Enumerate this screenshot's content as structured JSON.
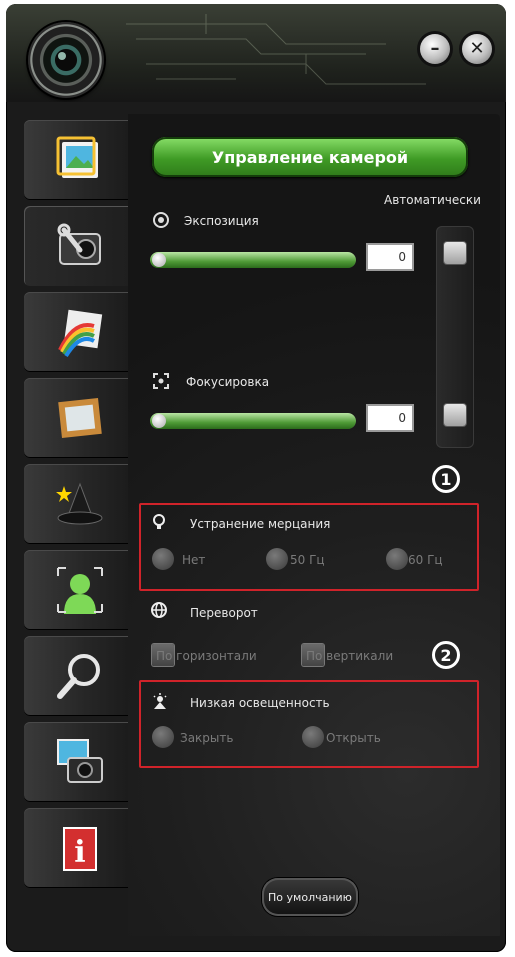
{
  "window": {
    "minimize_glyph": "–",
    "close_glyph": "✕"
  },
  "tabs": [
    {
      "name": "image-settings-tab",
      "icon": "picture-icon",
      "active": false
    },
    {
      "name": "camera-control-tab",
      "icon": "camera-wrench-icon",
      "active": true
    },
    {
      "name": "effects-tab",
      "icon": "rainbow-photo-icon",
      "active": false
    },
    {
      "name": "frames-tab",
      "icon": "frame-icon",
      "active": false
    },
    {
      "name": "magic-tab",
      "icon": "wizard-hat-icon",
      "active": false
    },
    {
      "name": "face-tracking-tab",
      "icon": "face-tracking-icon",
      "active": false
    },
    {
      "name": "zoom-tab",
      "icon": "magnifier-icon",
      "active": false
    },
    {
      "name": "capture-tab",
      "icon": "photo-camera-icon",
      "active": false
    },
    {
      "name": "info-tab",
      "icon": "info-icon",
      "active": false
    }
  ],
  "panel": {
    "title": "Управление камерой",
    "auto_label": "Автоматически",
    "exposure": {
      "label": "Экспозиция",
      "value": "0",
      "level": 0.0
    },
    "focus": {
      "label": "Фокусировка",
      "value": "0",
      "level": 0.0
    },
    "flicker": {
      "label": "Устранение мерцания",
      "options": [
        "Нет",
        "50 Гц",
        "60 Гц"
      ]
    },
    "flip": {
      "label": "Переворот",
      "options": [
        "По горизонтали",
        "По вертикали"
      ]
    },
    "lowlight": {
      "label": "Низкая освещенность",
      "options": [
        "Закрыть",
        "Открыть"
      ]
    },
    "default_button": "По умолчанию"
  },
  "callouts": [
    "1",
    "2"
  ],
  "colors": {
    "accent_green": "#4f9a36",
    "highlight_red": "#d0232a",
    "panel_bg": "#1b1b1b"
  }
}
